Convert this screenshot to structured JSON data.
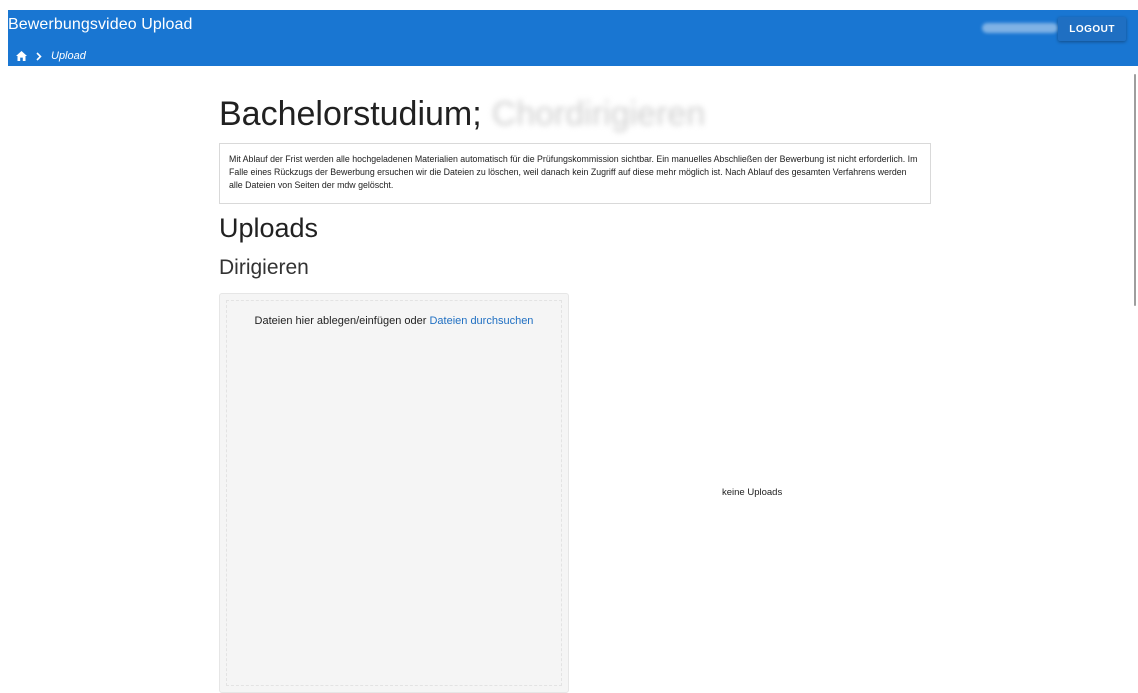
{
  "header": {
    "app_title": "Bewerbungsvideo Upload",
    "breadcrumb_current": "Upload",
    "logout_label": "LOGOUT",
    "home_icon": "home-icon",
    "chevron_icon": "chevron-right-icon"
  },
  "main": {
    "title": "Bachelorstudium;",
    "title_blurred": "Chordirigieren",
    "info_text": "Mit Ablauf der Frist werden alle hochgeladenen Materialien automatisch für die Prüfungskommission sichtbar. Ein manuelles Abschließen der Bewerbung ist nicht erforderlich. Im Falle eines Rückzugs der Bewerbung ersuchen wir die Dateien zu löschen, weil danach kein Zugriff auf diese mehr möglich ist. Nach Ablauf des gesamten Verfahrens werden alle Dateien von Seiten der mdw gelöscht.",
    "uploads_heading": "Uploads",
    "section_heading": "Dirigieren",
    "dropzone_text": "Dateien hier ablegen/einfügen oder ",
    "dropzone_link": "Dateien durchsuchen",
    "empty_label": "keine Uploads"
  },
  "colors": {
    "header_bg": "#1976d2",
    "link": "#1f6fc2"
  }
}
